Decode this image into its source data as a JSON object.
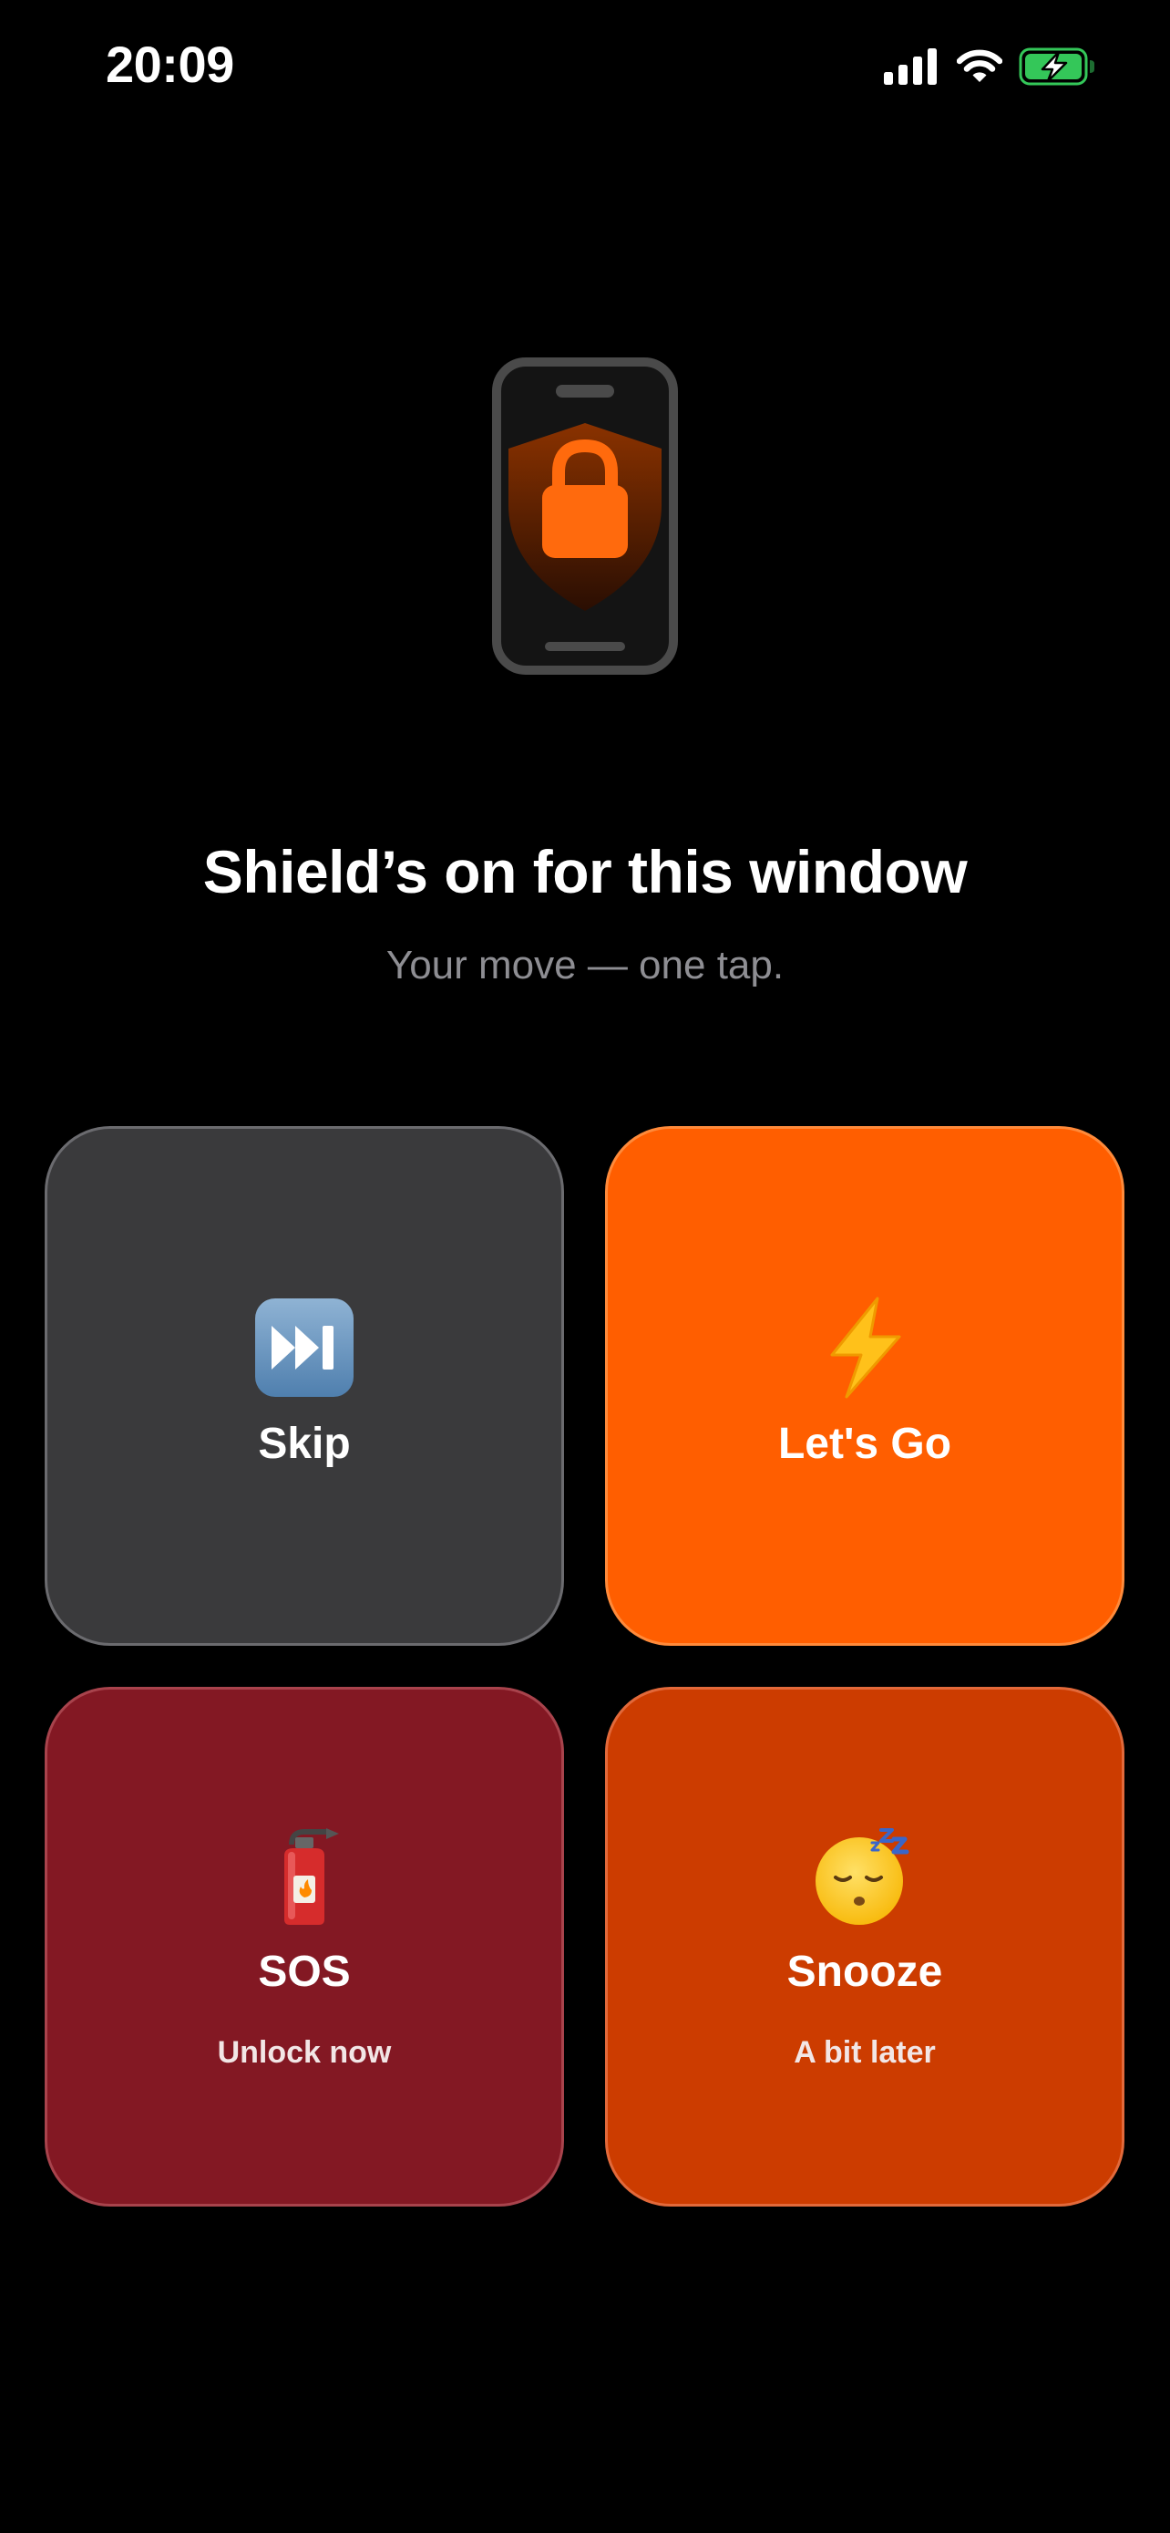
{
  "status_bar": {
    "time": "20:09",
    "icons": [
      "signal-icon",
      "wifi-icon",
      "battery-charging-icon"
    ],
    "battery_color": "#34c759"
  },
  "hero": {
    "icon": "phone-shield-lock-icon",
    "accent_color": "#ff6a0d",
    "title": "Shield’s on for this window",
    "subtitle": "Your move — one tap."
  },
  "actions": [
    {
      "id": "skip",
      "icon": "fast-forward-icon",
      "label": "Skip",
      "sublabel": "",
      "color": "#3a3a3c"
    },
    {
      "id": "lets-go",
      "icon": "lightning-icon",
      "label": "Let's Go",
      "sublabel": "",
      "color": "#ff5e00"
    },
    {
      "id": "sos",
      "icon": "fire-extinguisher-icon",
      "label": "SOS",
      "sublabel": "Unlock now",
      "color": "#831823"
    },
    {
      "id": "snooze",
      "icon": "sleeping-face-icon",
      "label": "Snooze",
      "sublabel": "A bit later",
      "color": "#cc3c00"
    }
  ]
}
